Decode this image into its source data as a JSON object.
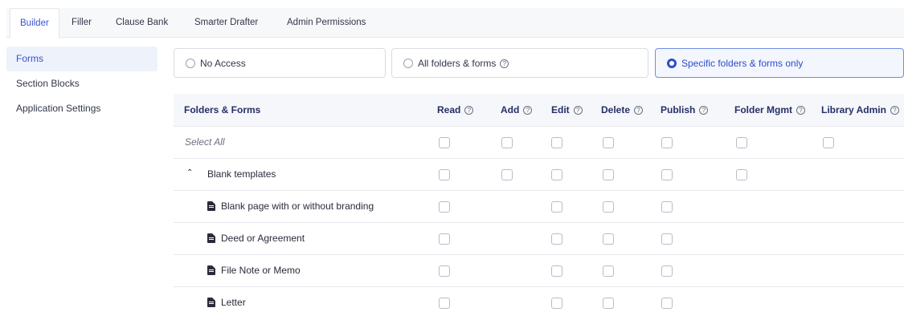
{
  "tabs": [
    "Builder",
    "Filler",
    "Clause Bank",
    "Smarter Drafter",
    "Admin Permissions"
  ],
  "sidebar": {
    "items": [
      "Forms",
      "Section Blocks",
      "Application Settings"
    ]
  },
  "access": {
    "options": [
      "No Access",
      "All folders & forms",
      "Specific folders & forms only"
    ],
    "selected": "Specific folders & forms only"
  },
  "table": {
    "columns": [
      "Folders & Forms",
      "Read",
      "Add",
      "Edit",
      "Delete",
      "Publish",
      "Folder Mgmt",
      "Library Admin"
    ],
    "rows": [
      {
        "label": "Select All"
      },
      {
        "label": "Blank templates"
      },
      {
        "label": "Blank page with or without branding"
      },
      {
        "label": "Deed or Agreement"
      },
      {
        "label": "File Note or Memo"
      },
      {
        "label": "Letter"
      }
    ]
  },
  "icons": {
    "help": "question-circle-icon",
    "expand": "chevron-up-icon",
    "document": "document-icon"
  },
  "colors": {
    "accent": "#3554d1",
    "header_text": "#262f66",
    "selected_bg": "#eef2fb"
  }
}
